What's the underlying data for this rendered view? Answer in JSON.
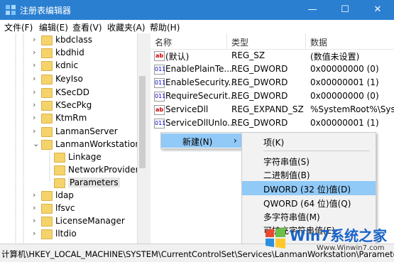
{
  "window": {
    "title": "注册表编辑器",
    "minimize": "—",
    "maximize": "☐",
    "close": "✕"
  },
  "menubar": [
    "文件(F)",
    "编辑(E)",
    "查看(V)",
    "收藏夹(A)",
    "帮助(H)"
  ],
  "tree": {
    "items": [
      {
        "label": "kbdclass",
        "expandable": true
      },
      {
        "label": "kbdhid",
        "expandable": true
      },
      {
        "label": "kdnic",
        "expandable": true
      },
      {
        "label": "KeyIso",
        "expandable": true
      },
      {
        "label": "KSecDD",
        "expandable": true
      },
      {
        "label": "KSecPkg",
        "expandable": true
      },
      {
        "label": "KtmRm",
        "expandable": true
      },
      {
        "label": "LanmanServer",
        "expandable": true
      },
      {
        "label": "LanmanWorkstation",
        "expandable": true
      },
      {
        "label": "Linkage",
        "expandable": false
      },
      {
        "label": "NetworkProvider",
        "expandable": false
      },
      {
        "label": "Parameters",
        "expandable": false
      },
      {
        "label": "ldap",
        "expandable": true
      },
      {
        "label": "lfsvc",
        "expandable": true
      },
      {
        "label": "LicenseManager",
        "expandable": true
      },
      {
        "label": "lltdio",
        "expandable": true
      }
    ]
  },
  "list": {
    "headers": [
      "名称",
      "类型",
      "数据"
    ],
    "rows": [
      {
        "icon": "ab",
        "name": "(默认)",
        "type": "REG_SZ",
        "data": "(数值未设置)"
      },
      {
        "icon": "bin",
        "name": "EnablePlainTe...",
        "type": "REG_DWORD",
        "data": "0x00000000 (0)"
      },
      {
        "icon": "bin",
        "name": "EnableSecurity...",
        "type": "REG_DWORD",
        "data": "0x00000001 (1)"
      },
      {
        "icon": "bin",
        "name": "RequireSecurit...",
        "type": "REG_DWORD",
        "data": "0x00000000 (0)"
      },
      {
        "icon": "ab",
        "name": "ServiceDll",
        "type": "REG_EXPAND_SZ",
        "data": "%SystemRoot%\\Syster"
      },
      {
        "icon": "bin",
        "name": "ServiceDllUnlo...",
        "type": "REG_DWORD",
        "data": "0x00000001 (1)"
      }
    ]
  },
  "icons": {
    "ab": "ab",
    "bin": "011"
  },
  "context_menu": {
    "new_label": "新建(N)",
    "arrow": "›"
  },
  "submenu": [
    "项(K)",
    "字符串值(S)",
    "二进制值(B)",
    "DWORD (32 位)值(D)",
    "QWORD (64 位)值(Q)",
    "多字符串值(M)",
    "可扩充字符串值(E)"
  ],
  "status": "计算机\\HKEY_LOCAL_MACHINE\\SYSTEM\\CurrentControlSet\\Services\\LanmanWorkstation\\Parameters",
  "watermark": {
    "brand": "Win7系统之家",
    "url": "Www.Winwin7.com"
  }
}
